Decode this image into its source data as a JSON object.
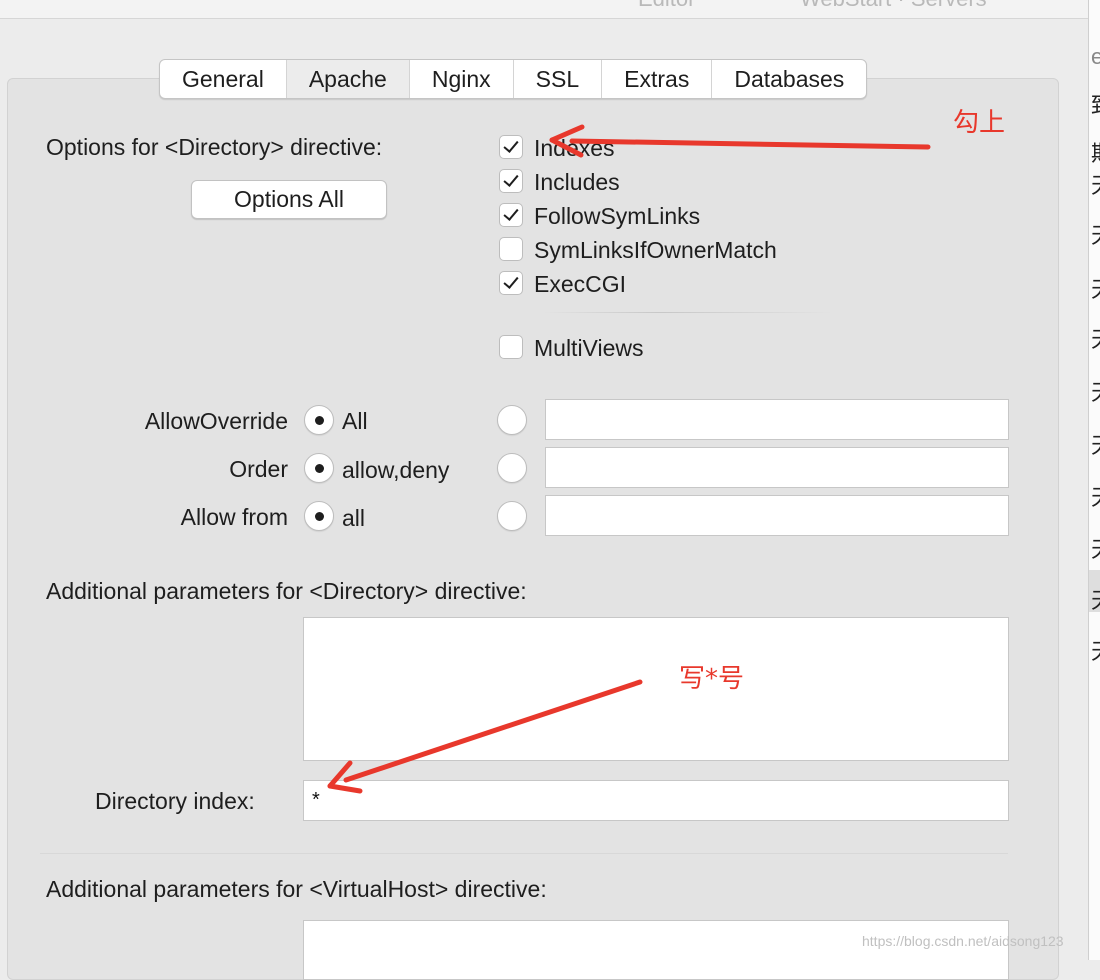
{
  "tabs": [
    "General",
    "Apache",
    "Nginx",
    "SSL",
    "Extras",
    "Databases"
  ],
  "selected_tab": "Apache",
  "options_label": "Options for <Directory> directive:",
  "options_all_button": "Options All",
  "options": [
    {
      "label": "Indexes",
      "checked": true
    },
    {
      "label": "Includes",
      "checked": true
    },
    {
      "label": "FollowSymLinks",
      "checked": true
    },
    {
      "label": "SymLinksIfOwnerMatch",
      "checked": false
    },
    {
      "label": "ExecCGI",
      "checked": true
    },
    {
      "label": "MultiViews",
      "checked": false
    }
  ],
  "allow_override": {
    "label": "AllowOverride",
    "selected_value": "All",
    "custom_value": ""
  },
  "order": {
    "label": "Order",
    "selected_value": "allow,deny",
    "custom_value": ""
  },
  "allow_from": {
    "label": "Allow from",
    "selected_value": "all",
    "custom_value": ""
  },
  "additional_directory": {
    "label": "Additional parameters for <Directory> directive:",
    "value": ""
  },
  "directory_index": {
    "label": "Directory index:",
    "value": "*"
  },
  "additional_virtualhost": {
    "label": "Additional parameters for <VirtualHost> directive:",
    "value": ""
  },
  "annotations": {
    "check_note": "勾上",
    "star_note": "写*号"
  },
  "watermark": "https://blog.csdn.net/aidsong123",
  "colors": {
    "annotation": "#e8382c",
    "panel": "#e3e3e3",
    "window": "#ececec"
  }
}
